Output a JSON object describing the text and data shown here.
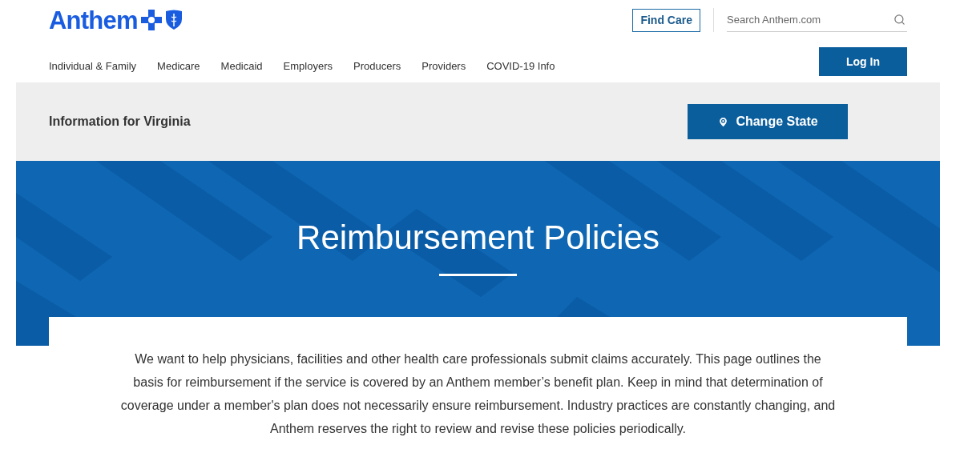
{
  "header": {
    "logo": "Anthem",
    "find_care": "Find Care",
    "search": {
      "placeholder": "Search Anthem.com"
    },
    "login": "Log In"
  },
  "nav": [
    "Individual & Family",
    "Medicare",
    "Medicaid",
    "Employers",
    "Producers",
    "Providers",
    "COVID-19 Info"
  ],
  "state_bar": {
    "label": "Information for Virginia",
    "button": "Change State"
  },
  "banner": {
    "title": "Reimbursement Policies"
  },
  "intro": "We want to help physicians, facilities and other health care professionals submit claims accurately. This page outlines the basis for reimbursement if the service is covered by an Anthem member’s benefit plan. Keep in mind that determination of coverage under a member's plan does not necessarily ensure reimbursement. Industry practices are constantly changing, and Anthem reserves the right to review and revise these policies periodically."
}
